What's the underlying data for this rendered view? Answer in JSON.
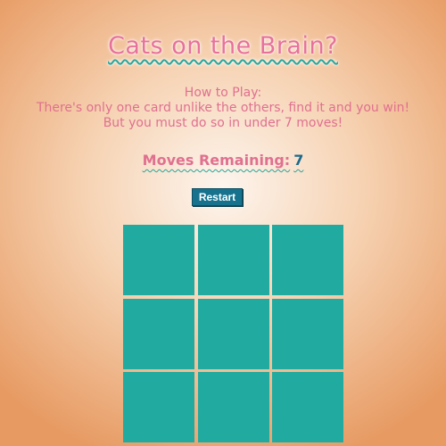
{
  "game": {
    "title": "Cats on the Brain?",
    "instructions": {
      "heading": "How to Play:",
      "line1": "There's only one card unlike the others, find it and you win!",
      "line2": "But you must do so in under 7 moves!"
    },
    "moves": {
      "label": "Moves Remaining:",
      "value": "7"
    },
    "restart_label": "Restart",
    "cards": [
      {
        "id": "card-1",
        "state": "face-down"
      },
      {
        "id": "card-2",
        "state": "face-down"
      },
      {
        "id": "card-3",
        "state": "face-down"
      },
      {
        "id": "card-4",
        "state": "face-down"
      },
      {
        "id": "card-5",
        "state": "face-down"
      },
      {
        "id": "card-6",
        "state": "face-down"
      },
      {
        "id": "card-7",
        "state": "face-down"
      },
      {
        "id": "card-8",
        "state": "face-down"
      },
      {
        "id": "card-9",
        "state": "face-down"
      }
    ]
  },
  "colors": {
    "title": "#e8719a",
    "accent_wave": "#2aa59a",
    "card_back": "#21aba0",
    "button": "#17728e",
    "background_edge": "#e79a62",
    "background_center": "#fdf5ee"
  }
}
